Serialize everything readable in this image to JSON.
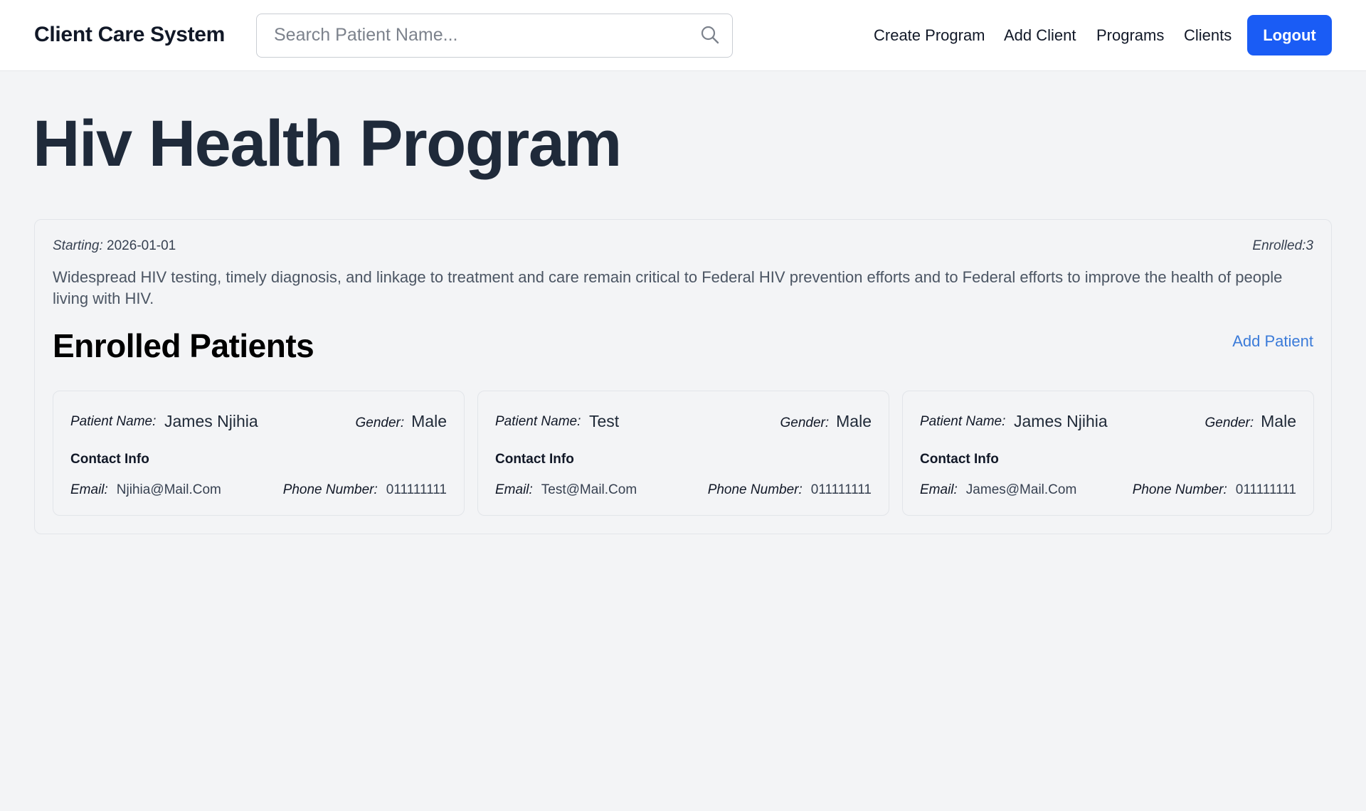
{
  "app": {
    "brand": "Client Care System",
    "search": {
      "placeholder": "Search Patient Name...",
      "value": ""
    },
    "nav": {
      "create_program": "Create Program",
      "add_client": "Add Client",
      "programs": "Programs",
      "clients": "Clients",
      "logout": "Logout"
    }
  },
  "program": {
    "title": "Hiv Health Program",
    "starting_label": "Starting:",
    "starting_date": "2026-01-01",
    "enrolled_label": "Enrolled:",
    "enrolled_count": "3",
    "description": "Widespread HIV testing, timely diagnosis, and linkage to treatment and care remain critical to Federal HIV prevention efforts and to Federal efforts to improve the health of people living with HIV."
  },
  "enrolled": {
    "title": "Enrolled Patients",
    "add_patient": "Add Patient",
    "labels": {
      "patient_name": "Patient Name:",
      "gender": "Gender:",
      "contact_info": "Contact Info",
      "email": "Email:",
      "phone": "Phone Number:"
    },
    "patients": [
      {
        "name": "James Njihia",
        "gender": "Male",
        "email": "Njihia@Mail.Com",
        "phone": "011111111"
      },
      {
        "name": "Test",
        "gender": "Male",
        "email": "Test@Mail.Com",
        "phone": "011111111"
      },
      {
        "name": "James Njihia",
        "gender": "Male",
        "email": "James@Mail.Com",
        "phone": "011111111"
      }
    ]
  },
  "colors": {
    "primary": "#1a5cf5",
    "link": "#3b7bd9",
    "background": "#f3f4f6",
    "title": "#1f2a3a"
  }
}
